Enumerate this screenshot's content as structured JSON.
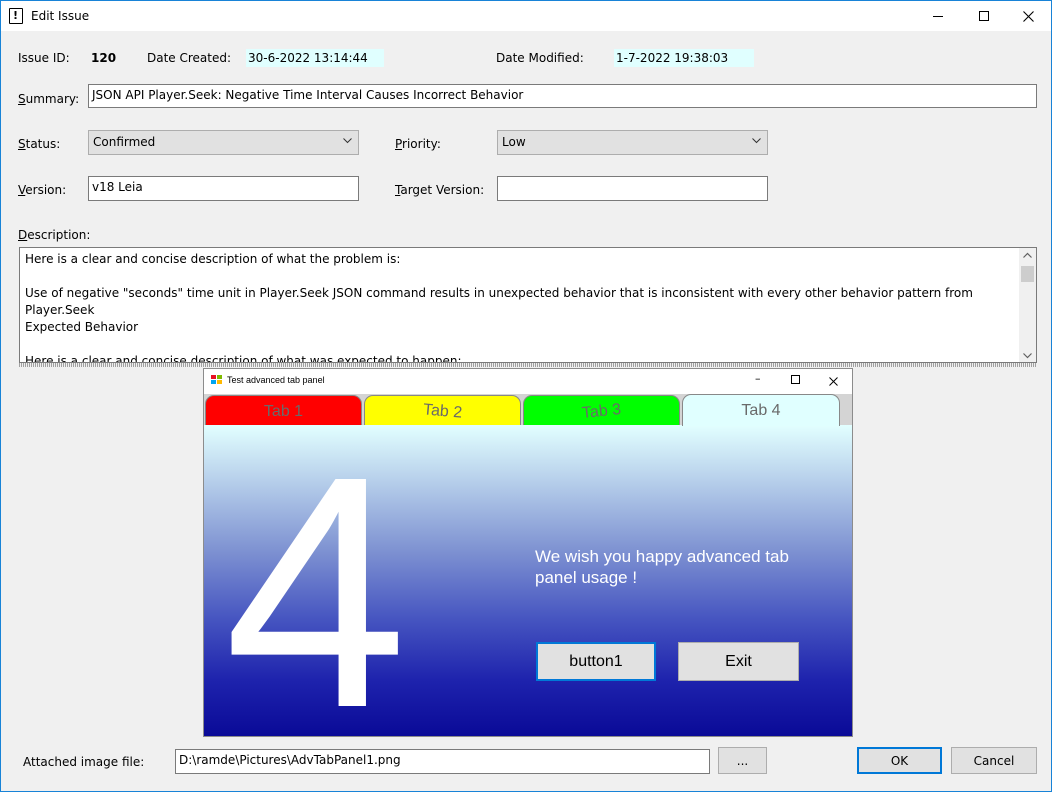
{
  "window": {
    "title": "Edit Issue"
  },
  "issue": {
    "id_label": "Issue ID:",
    "id_value": "120",
    "created_label": "Date Created:",
    "created_value": "30-6-2022 13:14:44",
    "modified_label": "Date Modified:",
    "modified_value": "1-7-2022 19:38:03"
  },
  "summary": {
    "mnemonic": "S",
    "label_rest": "ummary:",
    "value": "JSON API Player.Seek: Negative Time Interval Causes Incorrect Behavior"
  },
  "status": {
    "mnemonic": "S",
    "label_rest": "tatus:",
    "value": "Confirmed"
  },
  "priority": {
    "mnemonic": "P",
    "label_rest": "riority:",
    "value": "Low"
  },
  "version": {
    "mnemonic": "V",
    "label_rest": "ersion:",
    "value": "v18 Leia"
  },
  "target_version": {
    "mnemonic": "T",
    "label_rest": "arget Version:",
    "value": ""
  },
  "description": {
    "mnemonic": "D",
    "label_rest": "escription:",
    "lines": [
      "Here is a clear and concise description of what the problem is:",
      "",
      "Use of negative \"seconds\" time unit in Player.Seek JSON command results in unexpected behavior that is inconsistent with every other behavior pattern from Player.Seek",
      "Expected Behavior",
      "",
      "Here is a clear and concise description of what was expected to happen:"
    ]
  },
  "attached_image": {
    "title": "Test advanced tab panel",
    "tabs": [
      {
        "label": "Tab 1",
        "color": "#ff0000"
      },
      {
        "label": "Tab 2",
        "color": "#ffff00"
      },
      {
        "label": "Tab 3",
        "color": "#00ff00"
      },
      {
        "label": "Tab 4",
        "color": "#e0ffff"
      }
    ],
    "active_tab": 4,
    "big_number": "4",
    "message": "We wish you happy advanced tab panel usage !",
    "button1_label": "button1",
    "exit_label": "Exit"
  },
  "footer": {
    "file_label": "Attached image file:",
    "file_value": "D:\\ramde\\Pictures\\AdvTabPanel1.png",
    "browse_label": "...",
    "ok_label": "OK",
    "cancel_label": "Cancel"
  },
  "colors": {
    "readonly_bg": "#e0ffff",
    "accent": "#0078d7",
    "window_border": "#1883d7"
  },
  "icons": [
    "issue-document-icon",
    "minimize-icon",
    "maximize-icon",
    "close-icon",
    "chevron-down-icon",
    "scroll-up-icon",
    "scroll-down-icon",
    "app-icon"
  ]
}
